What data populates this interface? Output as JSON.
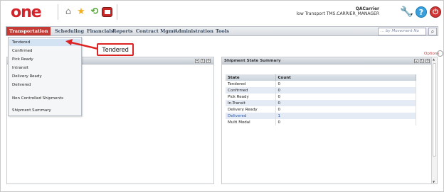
{
  "header": {
    "logo_text": "one",
    "user_name": "QACarrier",
    "user_role": "low Transport TMS.CARRIER_MANAGER"
  },
  "icons": {
    "home": "home-icon",
    "favorites": "star-icon",
    "refresh": "refresh-icon",
    "report": "report-icon",
    "settings": "wrench-icon",
    "help": "help-icon",
    "logout": "power-icon"
  },
  "nav": {
    "items": [
      "Transportation",
      "Scheduling",
      "Financials",
      "Reports",
      "Contract Mgmt",
      "Administration",
      "Tools"
    ],
    "active_color": "#c33b34",
    "search_placeholder": "... by Movement No"
  },
  "dropdown": {
    "items": [
      "Tendered",
      "Confirmed",
      "Pick Ready",
      "Intransit",
      "Delivery Ready",
      "Delivered",
      "Non Controlled Shipments",
      "Shipment Summary"
    ],
    "highlighted": "Tendered"
  },
  "callout": {
    "text": "Tendered",
    "color": "#dd2222"
  },
  "options_label": "Options",
  "summary": {
    "title": "Shipment State Summary",
    "columns": [
      "State",
      "Count"
    ],
    "rows": [
      {
        "state": "Tendered",
        "count": "0"
      },
      {
        "state": "Confirmed",
        "count": "0"
      },
      {
        "state": "Pick Ready",
        "count": "0"
      },
      {
        "state": "In-Transit",
        "count": "0"
      },
      {
        "state": "Delivery Ready",
        "count": "0"
      },
      {
        "state": "Delivered",
        "count": "1"
      },
      {
        "state": "Multi Modal",
        "count": "0"
      }
    ]
  }
}
